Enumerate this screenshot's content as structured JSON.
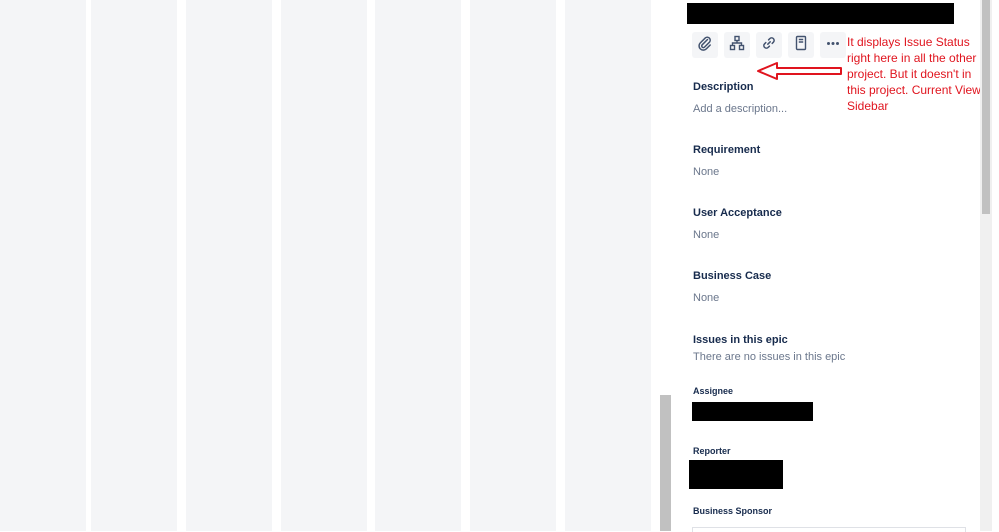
{
  "toolbar": {
    "icons": [
      "paperclip-icon",
      "hierarchy-icon",
      "link-icon",
      "document-icon",
      "more-icon"
    ]
  },
  "fields": {
    "description": {
      "label": "Description",
      "placeholder": "Add a description..."
    },
    "requirement": {
      "label": "Requirement",
      "value": "None"
    },
    "user_acceptance": {
      "label": "User Acceptance",
      "value": "None"
    },
    "business_case": {
      "label": "Business Case",
      "value": "None"
    },
    "issues_in_epic": {
      "label": "Issues in this epic",
      "value": "There are no issues in this epic"
    },
    "assignee": {
      "label": "Assignee"
    },
    "reporter": {
      "label": "Reporter"
    },
    "business_sponsor": {
      "label": "Business Sponsor"
    }
  },
  "annotation": {
    "text": "It displays Issue Status right here in all the other project. But it doesn't in this project. Current View: Sidebar"
  },
  "colors": {
    "board_column": "#f4f5f7",
    "annotation": "#e0141e",
    "text_primary": "#172b4d",
    "text_secondary": "#6b778c"
  }
}
